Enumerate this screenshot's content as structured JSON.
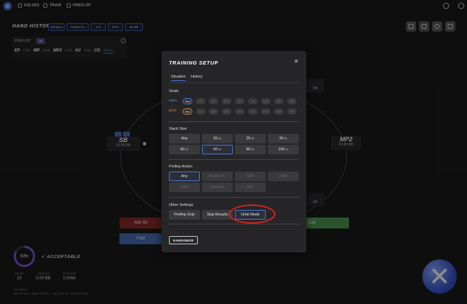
{
  "nav": {
    "solves": "SOLVES",
    "train": "TRAIN",
    "preflop": "PREFLOP"
  },
  "hand_history": {
    "title": "HAND HISTORY",
    "tags": [
      "Random",
      "Folded To",
      "CO",
      "BTN",
      "60 BB"
    ]
  },
  "preflop_panel": {
    "title": "PREFLOP",
    "cards": "A♠",
    "actions": [
      {
        "pos": "EP",
        "act": "Fold"
      },
      {
        "pos": "MP",
        "act": "Fold"
      },
      {
        "pos": "MP2",
        "act": "Fold"
      },
      {
        "pos": "HJ",
        "act": "Fold"
      },
      {
        "pos": "CO",
        "act": "Action"
      }
    ]
  },
  "seats": {
    "sb": {
      "name": "SB",
      "stack": "59.38 BB"
    },
    "mp2": {
      "name": "MP2",
      "stack": "59.88 BB"
    },
    "top_right_stack": "BB",
    "bottom_right_stack": "BB"
  },
  "bg_buttons": {
    "allin": "Allin 60",
    "fold": "Fold",
    "call": "Call"
  },
  "score": {
    "percent": 83,
    "percent_label": "83%",
    "verdict": "ACCEPTABLE"
  },
  "stats": [
    {
      "label": "Hands",
      "value": "23"
    },
    {
      "label": "Total EV",
      "value": "0.00 BB"
    },
    {
      "label": "EV/Hand",
      "value": "0.00bb"
    }
  ],
  "last_action": {
    "label": "Last Action",
    "text": "Allin (0.00%) - Raise (0.00%) - Call (70.00%) - Fold (30.00%)"
  },
  "modal": {
    "title": "TRAINING SETUP",
    "tabs": [
      "Situation",
      "History"
    ],
    "seats_section": "Seats",
    "hero_label": "Hero",
    "rtp_label": "RTP",
    "seat_options": [
      "Any",
      "EP",
      "MP",
      "MP2",
      "HJ",
      "CO",
      "BTN",
      "SB",
      "BB"
    ],
    "stack_section": "Stack Size",
    "stack_options": [
      {
        "v": "Any",
        "u": ""
      },
      {
        "v": "20",
        "u": "BB"
      },
      {
        "v": "25",
        "u": "BB"
      },
      {
        "v": "30",
        "u": "BB"
      },
      {
        "v": "40",
        "u": "BB"
      },
      {
        "v": "60",
        "u": "BB"
      },
      {
        "v": "80",
        "u": "BB"
      },
      {
        "v": "100",
        "u": "BB"
      }
    ],
    "preflop_section": "Preflop Action",
    "preflop_options": [
      "Any",
      "Folded To",
      "SRP",
      "3 Bet",
      "4 Bet",
      "Squeeze",
      "ISO"
    ],
    "other_section": "Other Settings",
    "other_options": [
      "Preflop Only",
      "Skip Results",
      "Orbit Mode"
    ],
    "randomize": "RANDOMIZE"
  },
  "colors": {
    "accent": "#4b7be0",
    "rtp": "#d98a2e",
    "highlight": "#e02020"
  }
}
